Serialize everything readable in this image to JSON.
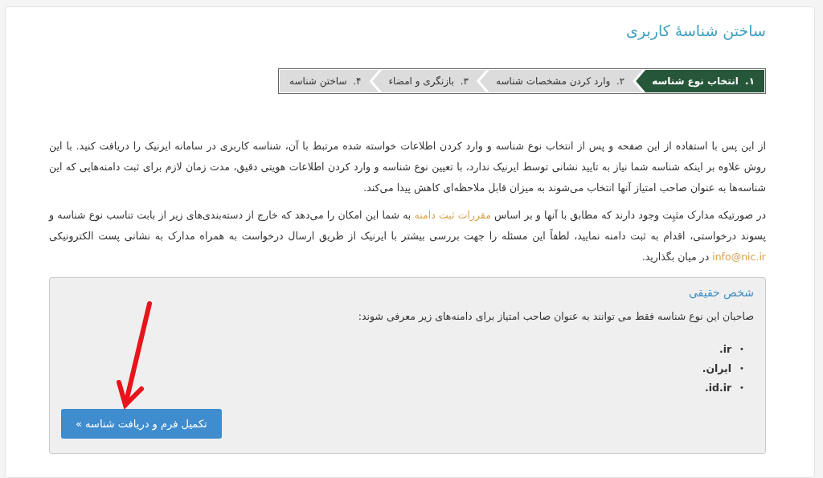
{
  "page": {
    "title": "ساختن شناسهٔ کاربری"
  },
  "steps": [
    {
      "number": "۱.",
      "label": "انتخاب نوع شناسه",
      "selected": true
    },
    {
      "number": "۲.",
      "label": "وارد کردن مشخصات شناسه",
      "selected": false
    },
    {
      "number": "۳.",
      "label": "بازنگری و امضاء",
      "selected": false
    },
    {
      "number": "۴.",
      "label": "ساختن شناسه",
      "selected": false
    }
  ],
  "paragraphs": [
    [
      {
        "kind": "text",
        "text": "از این پس با استفاده از این صفحه و پس از انتخاب نوع شناسه و وارد کردن اطلاعات خواسته شده مرتبط با آن، شناسه کاربری در سامانه ایرنیک را دریافت کنید. با این روش علاوه بر اینکه شناسه شما نیاز به تایید نشانی توسط ایرنیک ندارد، با تعیین نوع شناسه و وارد کردن اطلاعات هویتی دقیق، مدت زمان لازم برای ثبت دامنه‌هایی که این شناسه‌ها به عنوان صاحب امتیاز آنها انتخاب می‌شوند به میزان قابل ملاحظه‌ای کاهش پیدا می‌کند."
      }
    ],
    [
      {
        "kind": "text",
        "text": "در صورتیکه مدارک مثبِت وجود دارند که مطابق با آنها و بر اساس "
      },
      {
        "kind": "link",
        "text": "مقررات ثبت دامنه"
      },
      {
        "kind": "text",
        "text": " به شما این امکان را می‌دهد که خارج از دسته‌بندی‌های زیر از بابت تناسب نوع شناسه و پسوند درخواستی، اقدام به ثبت دامنه نمایید، لطفاً این مسئله را جهت بررسی بیشتر با ایرنیک از طریق ارسال درخواست به همراه مدارک به نشانی پست الکترونیکی "
      },
      {
        "kind": "link",
        "text": "info@nic.ir"
      },
      {
        "kind": "text",
        "text": " در میان بگذارید."
      }
    ]
  ],
  "panel": {
    "heading": "شخص حقیقی",
    "description": "صاحبان این نوع شناسه فقط می توانند به عنوان صاحب امتیاز برای دامنه‌های زیر معرفی شوند:",
    "domains": [
      {
        "bullet": "•",
        "text": ".ir"
      },
      {
        "bullet": "•",
        "text": ".ایران"
      },
      {
        "bullet": "•",
        "text": ".id.ir"
      }
    ],
    "button": "تکمیل فرم و دریافت شناسه »"
  }
}
